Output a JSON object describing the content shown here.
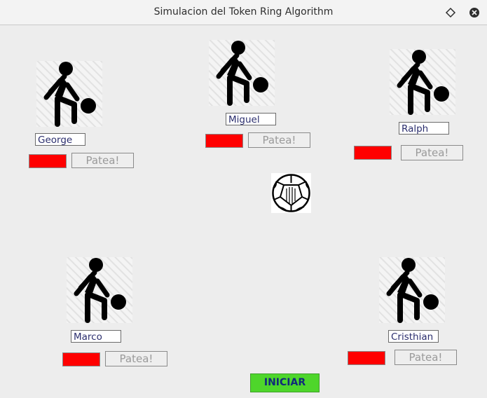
{
  "window": {
    "title": "Simulacion del Token Ring Algorithm"
  },
  "players": [
    {
      "name": "George",
      "kick_label": "Patea!",
      "status_color": "#ff0000",
      "icon": "player-kicking-ball-icon"
    },
    {
      "name": "Miguel",
      "kick_label": "Patea!",
      "status_color": "#ff0000",
      "icon": "player-kicking-ball-icon"
    },
    {
      "name": "Ralph",
      "kick_label": "Patea!",
      "status_color": "#ff0000",
      "icon": "player-kicking-ball-icon"
    },
    {
      "name": "Marco",
      "kick_label": "Patea!",
      "status_color": "#ff0000",
      "icon": "player-kicking-ball-icon"
    },
    {
      "name": "Cristhian",
      "kick_label": "Patea!",
      "status_color": "#ff0000",
      "icon": "player-kicking-ball-icon"
    }
  ],
  "ball": {
    "icon": "soccer-ball-icon"
  },
  "controls": {
    "start_label": "INICIAR",
    "start_color": "#4ed62b"
  }
}
